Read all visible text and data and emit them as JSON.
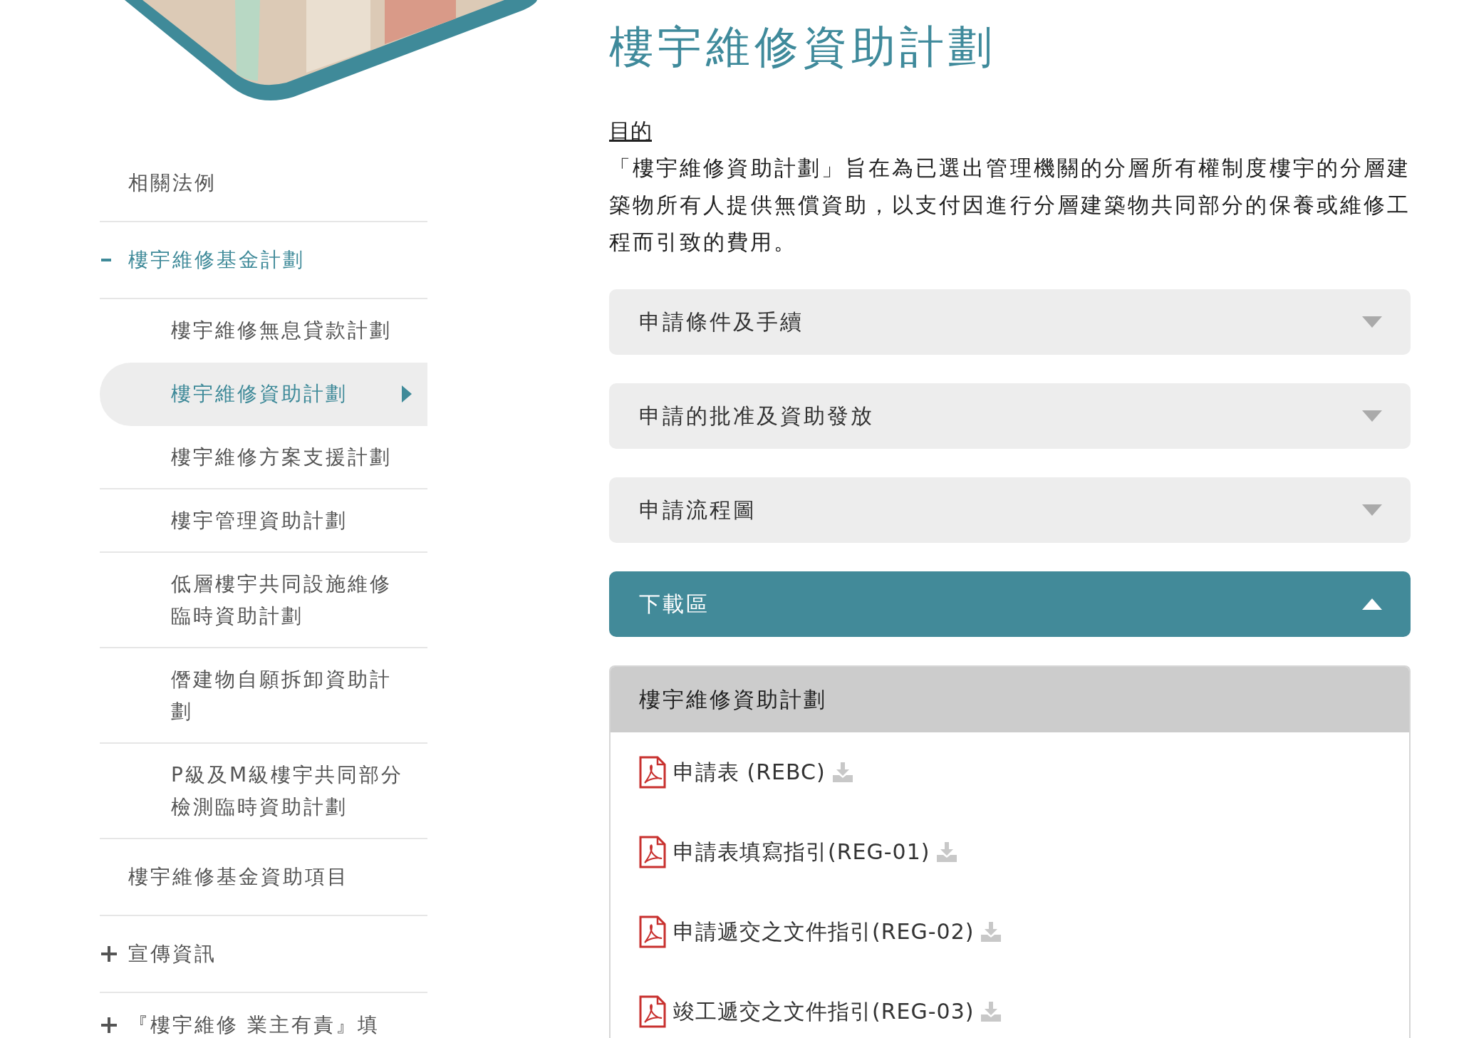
{
  "sidebar": {
    "items": [
      {
        "kind": "link",
        "label": "相關法例",
        "selected": false
      },
      {
        "kind": "group",
        "label": "樓宇維修基金計劃",
        "selected": true,
        "expanded": true,
        "children": [
          {
            "label": "樓宇維修無息貸款計劃",
            "selected": false
          },
          {
            "label": "樓宇維修資助計劃",
            "selected": true
          },
          {
            "label": "樓宇維修方案支援計劃",
            "selected": false
          },
          {
            "label": "樓宇管理資助計劃",
            "selected": false
          },
          {
            "label": "低層樓宇共同設施維修臨時資助計劃",
            "selected": false
          },
          {
            "label": "僭建物自願拆卸資助計劃",
            "selected": false
          },
          {
            "label": "P級及M級樓宇共同部分檢測臨時資助計劃",
            "selected": false
          }
        ]
      },
      {
        "kind": "link",
        "label": "樓宇維修基金資助項目",
        "selected": false
      },
      {
        "kind": "group",
        "label": "宣傳資訊",
        "selected": false,
        "expanded": false
      },
      {
        "kind": "group",
        "label": "『樓宇維修 業主有責』填",
        "selected": false,
        "expanded": false
      }
    ]
  },
  "main": {
    "title": "樓宇維修資助計劃",
    "purpose_heading": "目的",
    "purpose_text": "「樓宇維修資助計劃」旨在為已選出管理機關的分層所有權制度樓宇的分層建築物所有人提供無償資助，以支付因進行分層建築物共同部分的保養或維修工程而引致的費用。",
    "sections": [
      {
        "label": "申請條件及手續",
        "expanded": false
      },
      {
        "label": "申請的批准及資助發放",
        "expanded": false
      },
      {
        "label": "申請流程圖",
        "expanded": false
      },
      {
        "label": "下載區",
        "expanded": true
      }
    ],
    "downloads": {
      "heading": "樓宇維修資助計劃",
      "files": [
        {
          "label": "申請表 (REBC)"
        },
        {
          "label": "申請表填寫指引(REG-01)"
        },
        {
          "label": "申請遞交之文件指引(REG-02)"
        },
        {
          "label": "竣工遞交之文件指引(REG-03)"
        }
      ]
    }
  }
}
